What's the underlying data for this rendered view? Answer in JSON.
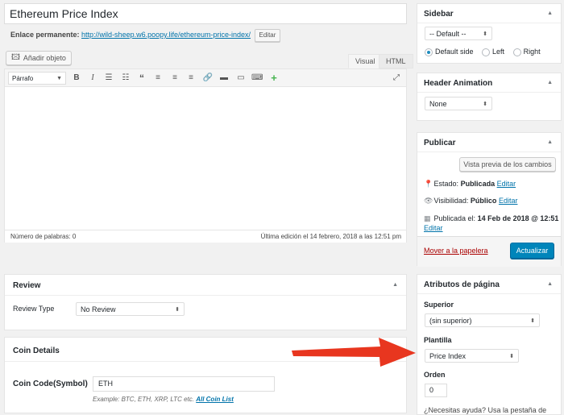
{
  "post": {
    "title": "Ethereum Price Index",
    "permalink_label": "Enlace permanente:",
    "permalink_url": "http://wild-sheep.w6.poopy.life/ethereum-price-index/",
    "permalink_edit": "Editar"
  },
  "editor": {
    "add_media": "Añadir objeto",
    "tab_visual": "Visual",
    "tab_html": "HTML",
    "format_value": "Párrafo",
    "toolbar_icons": [
      "bold-icon",
      "italic-icon",
      "bullet-list-icon",
      "numbered-list-icon",
      "blockquote-icon",
      "align-left-icon",
      "align-center-icon",
      "align-right-icon",
      "link-icon",
      "read-more-icon",
      "toolbar-toggle-icon",
      "keyboard-icon",
      "add-plus-icon",
      "fullscreen-icon"
    ],
    "word_count": "Número de palabras: 0",
    "last_edit": "Última edición el 14 febrero, 2018 a las 12:51 pm"
  },
  "review": {
    "title": "Review",
    "label": "Review Type",
    "value": "No Review"
  },
  "coin_details": {
    "title": "Coin Details",
    "label": "Coin Code(Symbol)",
    "value": "ETH",
    "help": "Example: BTC, ETH, XRP, LTC etc.",
    "help_link": "All Coin List"
  },
  "sidebar_box": {
    "title": "Sidebar",
    "select_value": "-- Default --",
    "options": [
      "Default side",
      "Left",
      "Right"
    ],
    "selected_option": "Default side"
  },
  "header_animation": {
    "title": "Header Animation",
    "value": "None"
  },
  "publish": {
    "title": "Publicar",
    "preview_button": "Vista previa de los cambios",
    "status_label": "Estado:",
    "status_value": "Publicada",
    "visibility_label": "Visibilidad:",
    "visibility_value": "Público",
    "published_label": "Publicada el:",
    "published_value": "14 Feb de 2018 @ 12:51",
    "edit": "Editar",
    "trash": "Mover a la papelera",
    "update_button": "Actualizar"
  },
  "page_attributes": {
    "title": "Atributos de página",
    "parent_label": "Superior",
    "parent_value": "(sin superior)",
    "template_label": "Plantilla",
    "template_value": "Price Index",
    "order_label": "Orden",
    "order_value": "0",
    "help_text": "¿Necesitas ayuda? Usa la pestaña de"
  },
  "colors": {
    "accent": "#0073aa",
    "primary_button": "#0085ba",
    "trash": "#a00",
    "annotation_arrow": "#e8361f"
  }
}
